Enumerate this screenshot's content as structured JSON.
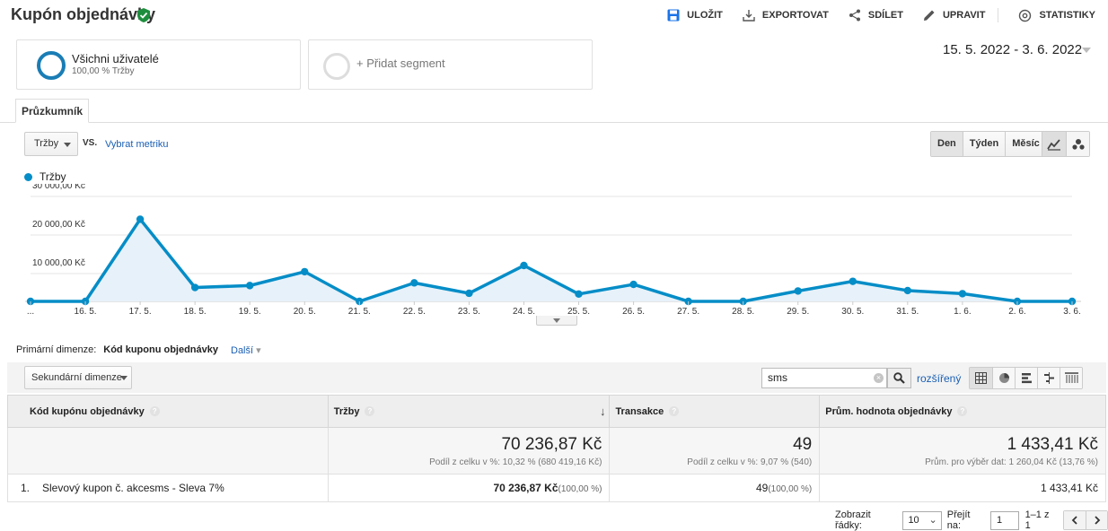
{
  "header": {
    "title": "Kupón objednávky",
    "actions": [
      {
        "label": "ULOŽIT",
        "icon": "save-icon"
      },
      {
        "label": "EXPORTOVAT",
        "icon": "export-icon"
      },
      {
        "label": "SDÍLET",
        "icon": "share-icon"
      },
      {
        "label": "UPRAVIT",
        "icon": "edit-icon"
      },
      {
        "label": "STATISTIKY",
        "icon": "insights-icon"
      }
    ]
  },
  "segments": {
    "active": {
      "name": "Všichni uživatelé",
      "sub": "100,00 % Tržby"
    },
    "add_label": "+ Přidat segment"
  },
  "date_range": "15. 5. 2022 - 3. 6. 2022",
  "explorer": {
    "tab": "Průzkumník",
    "metric": "Tržby",
    "vs": "VS.",
    "pick_metric": "Vybrat metriku",
    "granularity": [
      "Den",
      "Týden",
      "Měsíc"
    ],
    "legend": "Tržby"
  },
  "chart_data": {
    "type": "area",
    "series": [
      {
        "name": "Tržby",
        "color": "#058dc7"
      }
    ],
    "x": [
      "...",
      "16. 5.",
      "17. 5.",
      "18. 5.",
      "19. 5.",
      "20. 5.",
      "21. 5.",
      "22. 5.",
      "23. 5.",
      "24. 5.",
      "25. 5.",
      "26. 5.",
      "27. 5.",
      "28. 5.",
      "29. 5.",
      "30. 5.",
      "31. 5.",
      "1. 6.",
      "2. 6.",
      "3. 6."
    ],
    "values": [
      0,
      0,
      21300,
      3600,
      4100,
      7700,
      0,
      4800,
      2100,
      9300,
      1900,
      4400,
      0,
      0,
      2700,
      5200,
      2800,
      2000,
      0,
      0
    ],
    "ylim": [
      0,
      30000
    ],
    "yticks": [
      "30 000,00 Kč",
      "20 000,00 Kč",
      "10 000,00 Kč"
    ],
    "ytick_values": [
      30000,
      20000,
      10000
    ],
    "grid": true
  },
  "dimensions": {
    "primary_label": "Primární dimenze:",
    "primary_value": "Kód kuponu objednávky",
    "more": "Další",
    "secondary": "Sekundární dimenze"
  },
  "search": {
    "value": "sms",
    "advanced": "rozšířený"
  },
  "table": {
    "columns": [
      "Kód kupónu objednávky",
      "Tržby",
      "Transakce",
      "Prům. hodnota objednávky"
    ],
    "totals": [
      {
        "value": "70 236,87 Kč",
        "sub": "Podíl z celku v %: 10,32 % (680 419,16 Kč)"
      },
      {
        "value": "49",
        "sub": "Podíl z celku v %: 9,07 % (540)"
      },
      {
        "value": "1 433,41 Kč",
        "sub": "Prům. pro výběr dat: 1 260,04 Kč (13,76 %)"
      }
    ],
    "rows": [
      {
        "index": "1.",
        "coupon": "Slevový kupon č. akcesms - Sleva 7%",
        "revenue": "70 236,87 Kč",
        "revenue_pct": "(100,00 %)",
        "transactions": "49",
        "transactions_pct": "(100,00 %)",
        "avg": "1 433,41 Kč"
      }
    ]
  },
  "pager": {
    "rows_label": "Zobrazit řádky:",
    "rows_value": "10",
    "goto_label": "Přejít na:",
    "goto_value": "1",
    "range": "1–1 z 1"
  }
}
